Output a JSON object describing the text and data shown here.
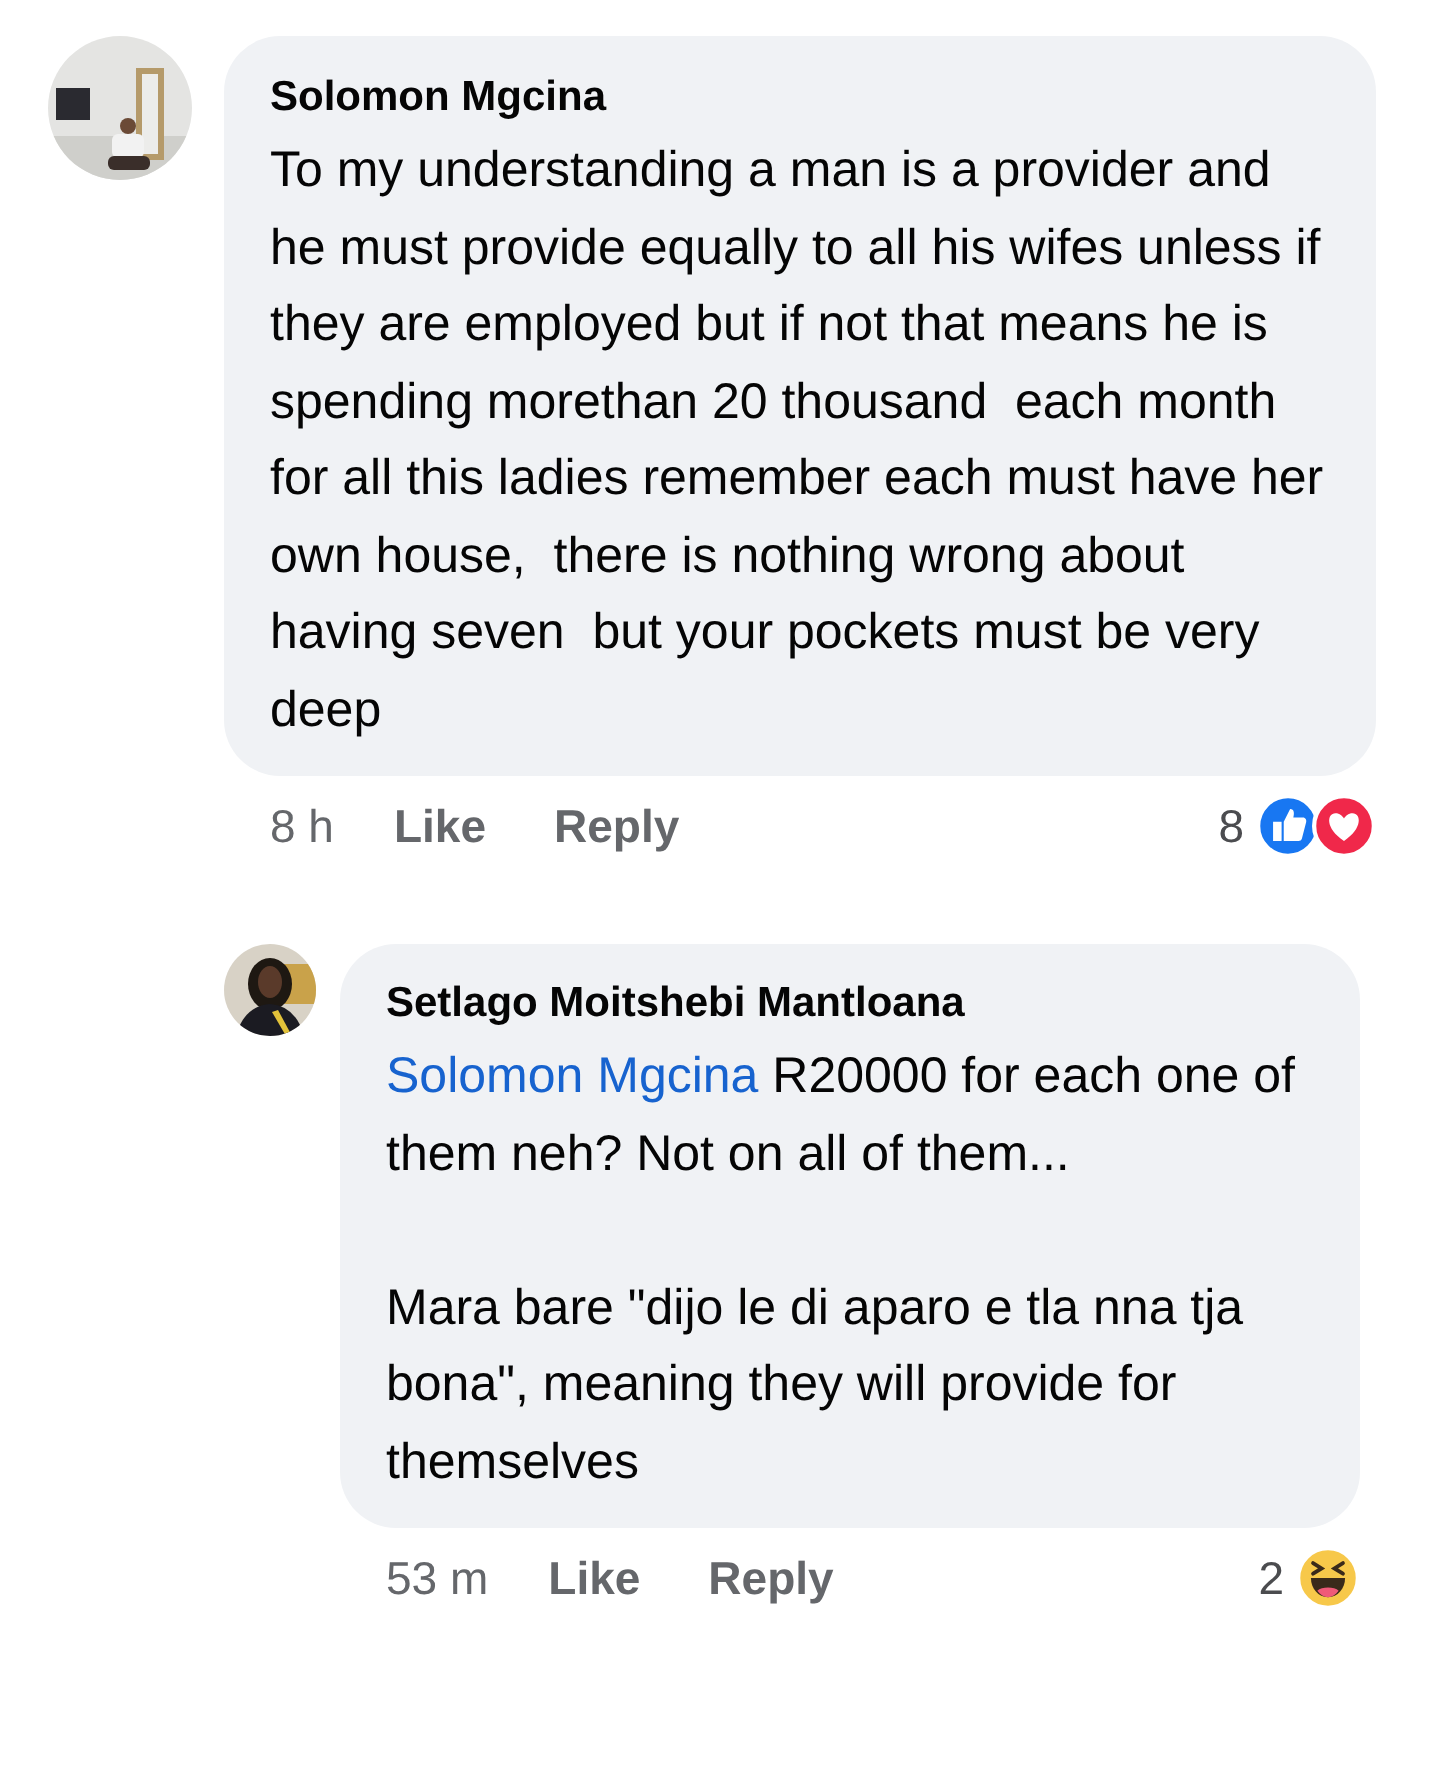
{
  "comments": [
    {
      "author": "Solomon Mgcina",
      "body": [
        "To my understanding a man is a provider and he must provide equally to all his wifes unless if they are employed but if not that means he is spending morethan 20 thousand  each month for all this ladies remember each must have her own house,  there is nothing wrong about having seven  but your pockets must be very deep"
      ],
      "time": "8 h",
      "like": "Like",
      "reply": "Reply",
      "reaction_count": "8",
      "reactions": [
        {
          "kind": "like"
        },
        {
          "kind": "love"
        }
      ],
      "replies": [
        {
          "author": "Setlago Moitshebi Mantloana",
          "mention": "Solomon Mgcina",
          "body": [
            " R20000 for each one of them neh? Not on all of them...",
            "Mara bare \"dijo le di aparo e tla nna tja bona\", meaning they will provide for themselves"
          ],
          "time": "53 m",
          "like": "Like",
          "reply": "Reply",
          "reaction_count": "2",
          "reactions": [
            {
              "kind": "haha"
            }
          ]
        }
      ]
    }
  ]
}
